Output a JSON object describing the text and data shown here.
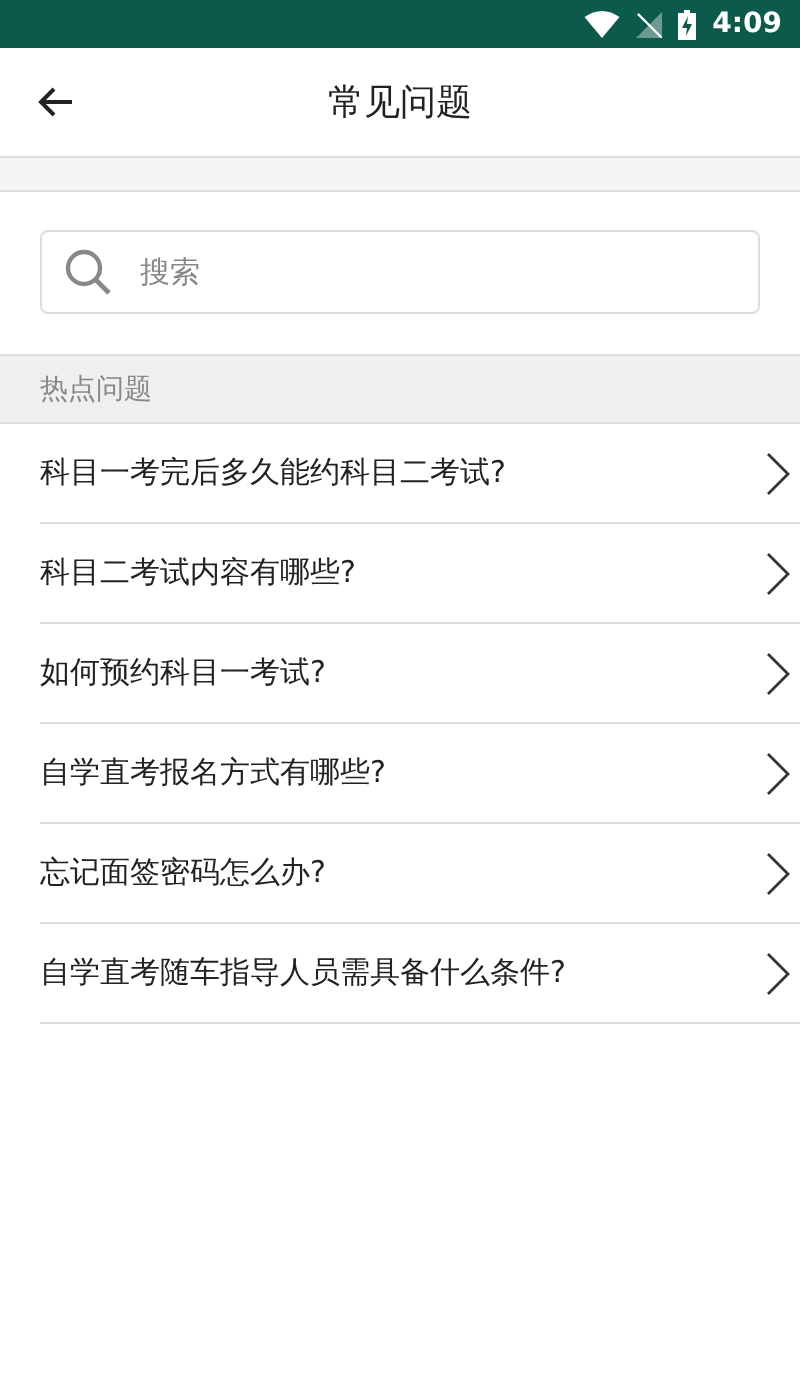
{
  "status_bar": {
    "time": "4:09"
  },
  "app_bar": {
    "title": "常见问题"
  },
  "search": {
    "placeholder": "搜索"
  },
  "section": {
    "title": "热点问题"
  },
  "questions": [
    {
      "text": "科目一考完后多久能约科目二考试?"
    },
    {
      "text": "科目二考试内容有哪些?"
    },
    {
      "text": "如何预约科目一考试?"
    },
    {
      "text": "自学直考报名方式有哪些?"
    },
    {
      "text": "忘记面签密码怎么办?"
    },
    {
      "text": "自学直考随车指导人员需具备什么条件?"
    }
  ]
}
